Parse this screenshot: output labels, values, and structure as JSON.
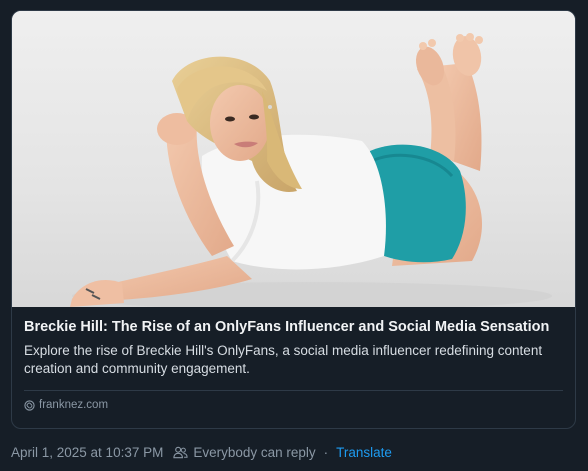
{
  "link_card": {
    "image_alt": "Woman with blonde hair lying on the floor in a white t-shirt and teal shorts",
    "title": "Breckie Hill: The Rise of an OnlyFans Influencer and Social Media Sensation",
    "description": "Explore the rise of Breckie Hill's OnlyFans, a social media influencer redefining content creation and community engagement.",
    "domain": "franknez.com",
    "domain_icon": "link-icon"
  },
  "post_meta": {
    "timestamp": "April 1, 2025 at 10:37 PM",
    "reply_setting": "Everybody can reply",
    "reply_icon": "people-icon",
    "separator": "·",
    "translate_label": "Translate"
  },
  "colors": {
    "background": "#161e27",
    "card_border": "#2e3a47",
    "link_blue": "#1d9bf0",
    "muted_text": "#8b98a5",
    "shorts_teal": "#1f9ea6"
  }
}
